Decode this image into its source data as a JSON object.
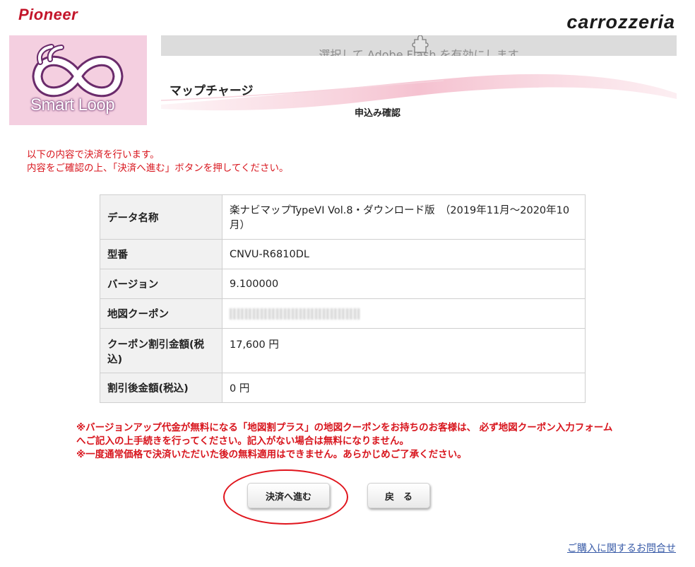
{
  "header": {
    "brand_left": "Pioneer",
    "brand_right": "carrozzeria",
    "smartloop_label": "Smart Loop",
    "flash_notice": "選択して Adobe Flash を有効にします",
    "page_title": "マップチャージ",
    "page_subtitle": "申込み確認"
  },
  "notice": {
    "line1": "以下の内容で決済を行います。",
    "line2": "内容をご確認の上、「決済へ進む」ボタンを押してください。"
  },
  "details": {
    "rows": [
      {
        "label": "データ名称",
        "value": "楽ナビマップTypeVI Vol.8・ダウンロード版　（2019年11月～2020年10月）"
      },
      {
        "label": "型番",
        "value": "CNVU-R6810DL"
      },
      {
        "label": "バージョン",
        "value": "9.100000"
      },
      {
        "label": "地図クーポン",
        "value": ""
      },
      {
        "label": "クーポン割引金額(税込)",
        "value": "17,600 円"
      },
      {
        "label": "割引後金額(税込)",
        "value": "0 円"
      }
    ]
  },
  "warning": {
    "line1": "※バージョンアップ代金が無料になる「地図割プラス」の地図クーポンをお持ちのお客様は、 必ず地図クーポン入力フォームへご記入の上手続きを行ってください。記入がない場合は無料になりません。",
    "line2": "※一度通常価格で決済いただいた後の無料適用はできません。あらかじめご了承ください。"
  },
  "buttons": {
    "proceed": "決済へ進む",
    "back": "戻　る"
  },
  "footer": {
    "contact_link": "ご購入に関するお問合せ"
  },
  "colors": {
    "brand_red": "#c3152a",
    "notice_red": "#d8151d",
    "link_blue": "#3a5ca8",
    "smartloop_pink": "#f4cfe0"
  }
}
